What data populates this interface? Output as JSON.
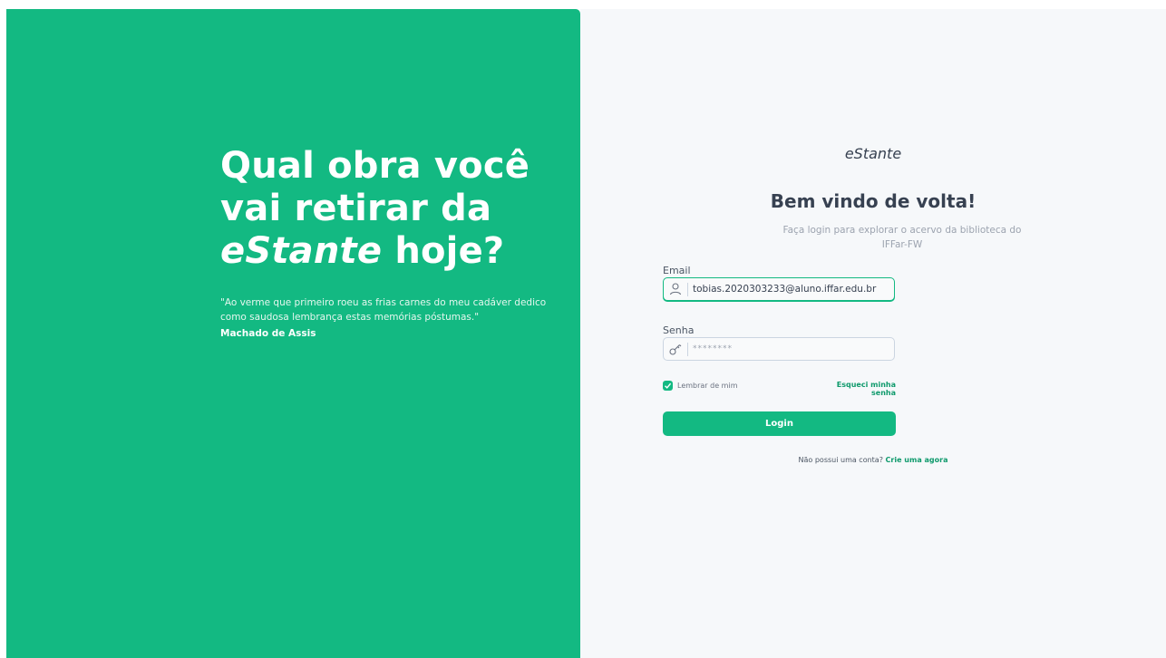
{
  "hero": {
    "title_line1": "Qual obra você",
    "title_line2": "vai retirar da",
    "title_em": "eStante",
    "title_end": " hoje?",
    "quote": "\"Ao verme que primeiro roeu as frias carnes do meu cadáver dedico como saudosa lembrança estas memórias póstumas.\"",
    "author": "Machado de Assis"
  },
  "login": {
    "logo": "eStante",
    "welcome": "Bem vindo de volta!",
    "subtitle": "Faça login para explorar o acervo da biblioteca do IFFar-FW",
    "email_label": "Email",
    "email_value": "tobias.2020303233@aluno.iffar.edu.br",
    "password_label": "Senha",
    "password_value": "********",
    "remember_label": "Lembrar de mim",
    "remember_checked": true,
    "forgot_label": "Esqueci minha senha",
    "login_button": "Login",
    "signup_prompt": "Não possui uma conta?",
    "signup_link": "Crie uma agora"
  },
  "icons": {
    "email_field": "user-icon",
    "password_field": "key-icon",
    "remember": "check-icon"
  },
  "colors": {
    "brand": "#13b982",
    "panel_bg": "#f6f8fa",
    "heading": "#374151"
  }
}
